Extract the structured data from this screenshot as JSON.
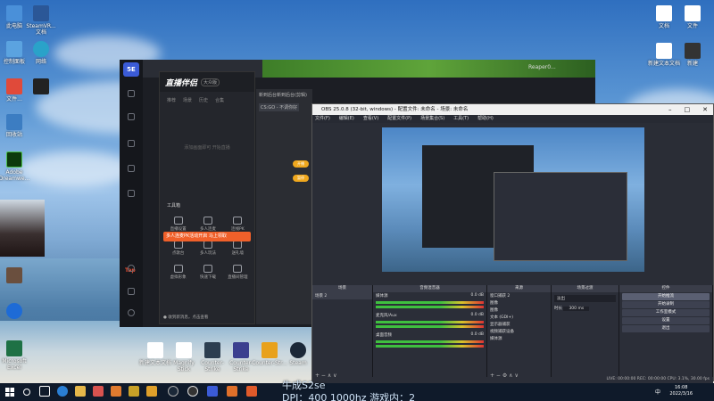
{
  "desktop": {
    "icons_left": [
      {
        "label": "此电脑"
      },
      {
        "label": "SteamVR... 文档"
      },
      {
        "label": "控制面板"
      },
      {
        "label": "网络"
      },
      {
        "label": "文件..."
      },
      {
        "label": "Adobe Dreamwe..."
      },
      {
        "label": "回收站"
      },
      {
        "label": "Microsoft Excel"
      }
    ],
    "icons_top_right": [
      {
        "label": "文档"
      },
      {
        "label": "文件"
      },
      {
        "label": "新建文本文档"
      },
      {
        "label": "新建"
      }
    ],
    "bottom_shortcuts": [
      {
        "label": "新建文本文档"
      },
      {
        "label": "Magnify Stick"
      },
      {
        "label": "Counter-Strike"
      },
      {
        "label": "Counter-Strike"
      },
      {
        "label": "Counter-Str..."
      },
      {
        "label": "Steam"
      }
    ]
  },
  "game_window": {
    "logo": "5E",
    "tag": "Tap",
    "user": "Reaper0..."
  },
  "live_helper": {
    "title": "直播伴侣",
    "badge": "大众版",
    "tabs": [
      "推荐",
      "场景",
      "历史",
      "合集"
    ],
    "hint": "添加画面即可 开始直播",
    "tools_title": "工具箱",
    "banner": "多人连麦PK活动开启 马上领取",
    "tools": [
      {
        "label": "直播设置"
      },
      {
        "label": "多人连麦"
      },
      {
        "label": "连线PK"
      },
      {
        "label": "点歌台"
      },
      {
        "label": "多人玩法"
      },
      {
        "label": "送礼墙"
      },
      {
        "label": "虚拟形象"
      },
      {
        "label": "快速下载"
      },
      {
        "label": "直播间管理"
      }
    ],
    "footer": "● 收到新消息，点击查看"
  },
  "middle_panel": {
    "title": "新到后台新到后台(剪辑)",
    "cs_label": "CS:GO - 不调你好",
    "pills": [
      "开播",
      "暂停"
    ]
  },
  "obs": {
    "title": "OBS 25.0.8 (32-bit, windows) - 配置文件: 未命名 - 场景: 未命名",
    "menu": [
      "文件(F)",
      "编辑(E)",
      "查看(V)",
      "配置文件(P)",
      "场景集合(S)",
      "工具(T)",
      "帮助(H)"
    ],
    "docks": {
      "scenes": {
        "header": "场景",
        "items": [
          "场景 2"
        ]
      },
      "sources": {
        "header": "来源",
        "items": [
          "窗口捕获 2",
          "图像",
          "图像",
          "文本 (GDI+)",
          "显示器捕获",
          "视频捕获设备",
          "媒体源"
        ]
      },
      "mixer": {
        "header": "音频混音器",
        "tracks": [
          "媒体源",
          "麦克风/Aux",
          "桌面音频"
        ],
        "levels": [
          "0.0 dB",
          "0.0 dB",
          "0.0 dB"
        ]
      },
      "transitions": {
        "header": "场景过渡",
        "type": "淡出",
        "duration_label": "时长",
        "duration": "300 ms"
      },
      "controls": {
        "header": "控件",
        "buttons": [
          "开始推流",
          "开始录制",
          "工作室模式",
          "设置",
          "退出"
        ]
      }
    },
    "statusbar": "LIVE: 00:00:00  REC: 00:00:00  CPU: 3.1%, 30.00 fps"
  },
  "taskbar": {
    "time": "16:08",
    "date": "2022/3/16",
    "tray": "中"
  },
  "overlay": {
    "line1": "牛成S2se",
    "line2": "DPI：400 1000hz 游戏内：2"
  }
}
